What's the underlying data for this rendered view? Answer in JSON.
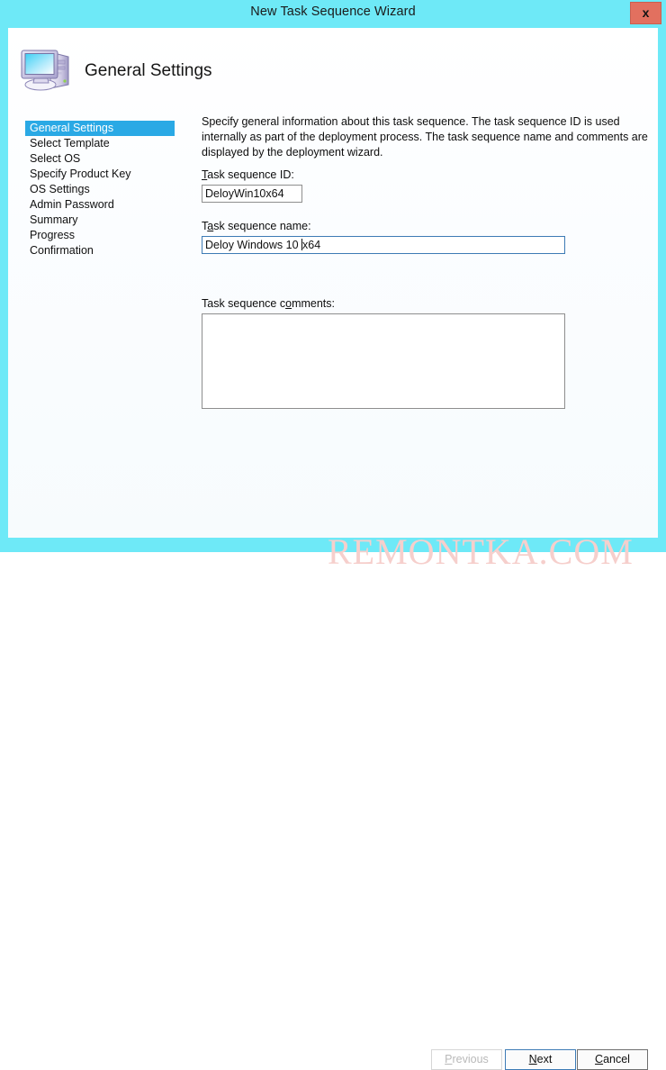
{
  "window": {
    "title": "New Task Sequence Wizard",
    "close_label": "x",
    "titlebar_color": "#6ee9f7",
    "close_color": "#e2705f"
  },
  "header": {
    "title": "General Settings",
    "icon": "computer-icon"
  },
  "sidebar": {
    "selected_index": 0,
    "highlight_color": "#2aa9e5",
    "items": [
      {
        "label": "General Settings"
      },
      {
        "label": "Select Template"
      },
      {
        "label": "Select OS"
      },
      {
        "label": "Specify Product Key"
      },
      {
        "label": "OS Settings"
      },
      {
        "label": "Admin Password"
      },
      {
        "label": "Summary"
      },
      {
        "label": "Progress"
      },
      {
        "label": "Confirmation"
      }
    ]
  },
  "main": {
    "description": "Specify general information about this task sequence.  The task sequence ID is used internally as part of the deployment process.  The task sequence name and comments are displayed by the deployment wizard.",
    "task_sequence_id": {
      "label_pre": "T",
      "label_accel": "",
      "label_post": "ask sequence ID:",
      "value": "DeloyWin10x64",
      "placeholder": ""
    },
    "task_sequence_name": {
      "label_pre": "T",
      "label_accel": "a",
      "label_post": "sk sequence name:",
      "value_before_caret": "Deloy Windows 10 ",
      "value_after_caret": "x64",
      "value": "Deloy Windows 10 x64",
      "placeholder": "",
      "focused": true
    },
    "task_sequence_comments": {
      "label_pre": "Task sequence c",
      "label_accel": "o",
      "label_post": "mments:",
      "value": "",
      "placeholder": ""
    }
  },
  "footer": {
    "previous": {
      "pre": "P",
      "accel": "",
      "post": "revious",
      "label": "Previous",
      "enabled": false
    },
    "next": {
      "pre": "",
      "accel": "N",
      "post": "ext",
      "label": "Next",
      "enabled": true,
      "focused": true
    },
    "cancel": {
      "pre": "",
      "accel": "C",
      "post": "ancel",
      "label": "Cancel",
      "enabled": true
    }
  },
  "watermark": {
    "text": "REMONTKA.COM",
    "color": "#f6cfcc"
  }
}
